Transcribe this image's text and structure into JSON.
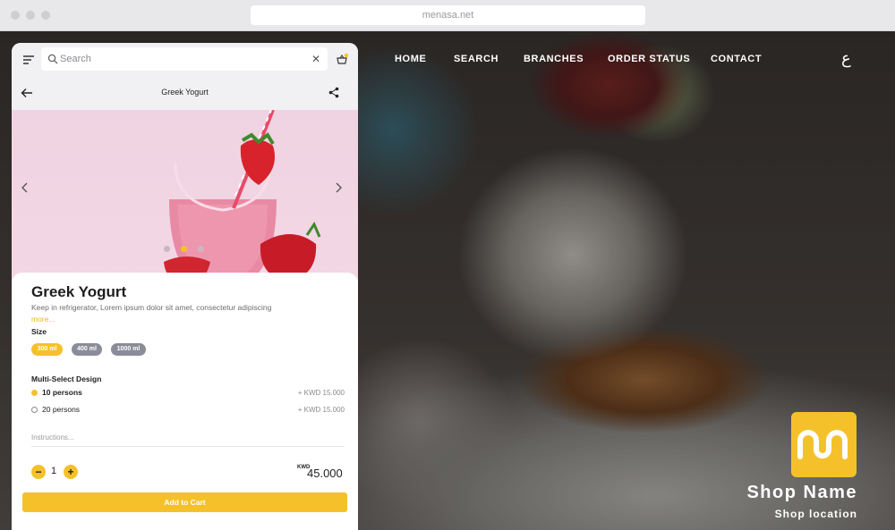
{
  "browser": {
    "url": "menasa.net"
  },
  "nav": {
    "items": [
      "HOME",
      "SEARCH",
      "BRANCHES",
      "ORDER STATUS",
      "CONTACT"
    ],
    "language": "ع"
  },
  "shop": {
    "name": "Shop Name",
    "location": "Shop location"
  },
  "app": {
    "search_placeholder": "Search",
    "page_title": "Greek Yogurt",
    "product": {
      "name": "Greek Yogurt",
      "description": "Keep in refrigerator, Lorem ipsum dolor sit amet, consectetur adipiscing",
      "more": "more..."
    },
    "size": {
      "label": "Size",
      "options": [
        "300 ml",
        "400 ml",
        "1000 ml"
      ],
      "selected": "300 ml"
    },
    "multi_select": {
      "label": "Multi-Select Design",
      "options": [
        {
          "label": "10 persons",
          "price": "+ KWD 15.000",
          "selected": true
        },
        {
          "label": "20 persons",
          "price": "+ KWD 15.000",
          "selected": false
        }
      ]
    },
    "instructions_placeholder": "Instructions...",
    "quantity": {
      "minus": "−",
      "value": "1",
      "plus": "+"
    },
    "total": {
      "currency": "KWD",
      "amount": "45.000"
    },
    "add_to_cart": "Add to Cart",
    "carousel": {
      "slides": 3,
      "active": 2
    }
  },
  "colors": {
    "accent": "#f5c12b",
    "chip_inactive": "#8b8c99"
  }
}
